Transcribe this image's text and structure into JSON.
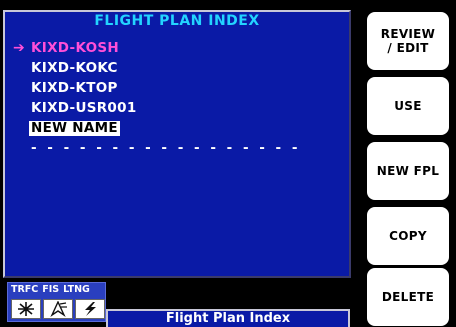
{
  "panel": {
    "title": "FLIGHT PLAN INDEX",
    "selector_arrow": "➔",
    "plans": [
      {
        "name": "KIXD-KOSH",
        "selected": true
      },
      {
        "name": "KIXD-KOKC",
        "selected": false
      },
      {
        "name": "KIXD-KTOP",
        "selected": false
      },
      {
        "name": "KIXD-USR001",
        "selected": false
      }
    ],
    "new_name_label": "NEW NAME",
    "empty_slot": "- - - - - - - - - - - - - - - - -"
  },
  "softkeys": {
    "review_edit": "REVIEW\n/ EDIT",
    "use": "USE",
    "new_fpl": "NEW FPL",
    "copy": "COPY",
    "delete": "DELETE"
  },
  "status_widget": {
    "traffic_label": "TRFC",
    "fis_label": "FIS",
    "lightning_label": "LTNG"
  },
  "page_title": "Flight Plan Index",
  "colors": {
    "panel_bg": "#0a1aa6",
    "title_cyan": "#23d4ff",
    "selected_magenta": "#ff4fd8",
    "softkey_bg": "#ffffff"
  }
}
